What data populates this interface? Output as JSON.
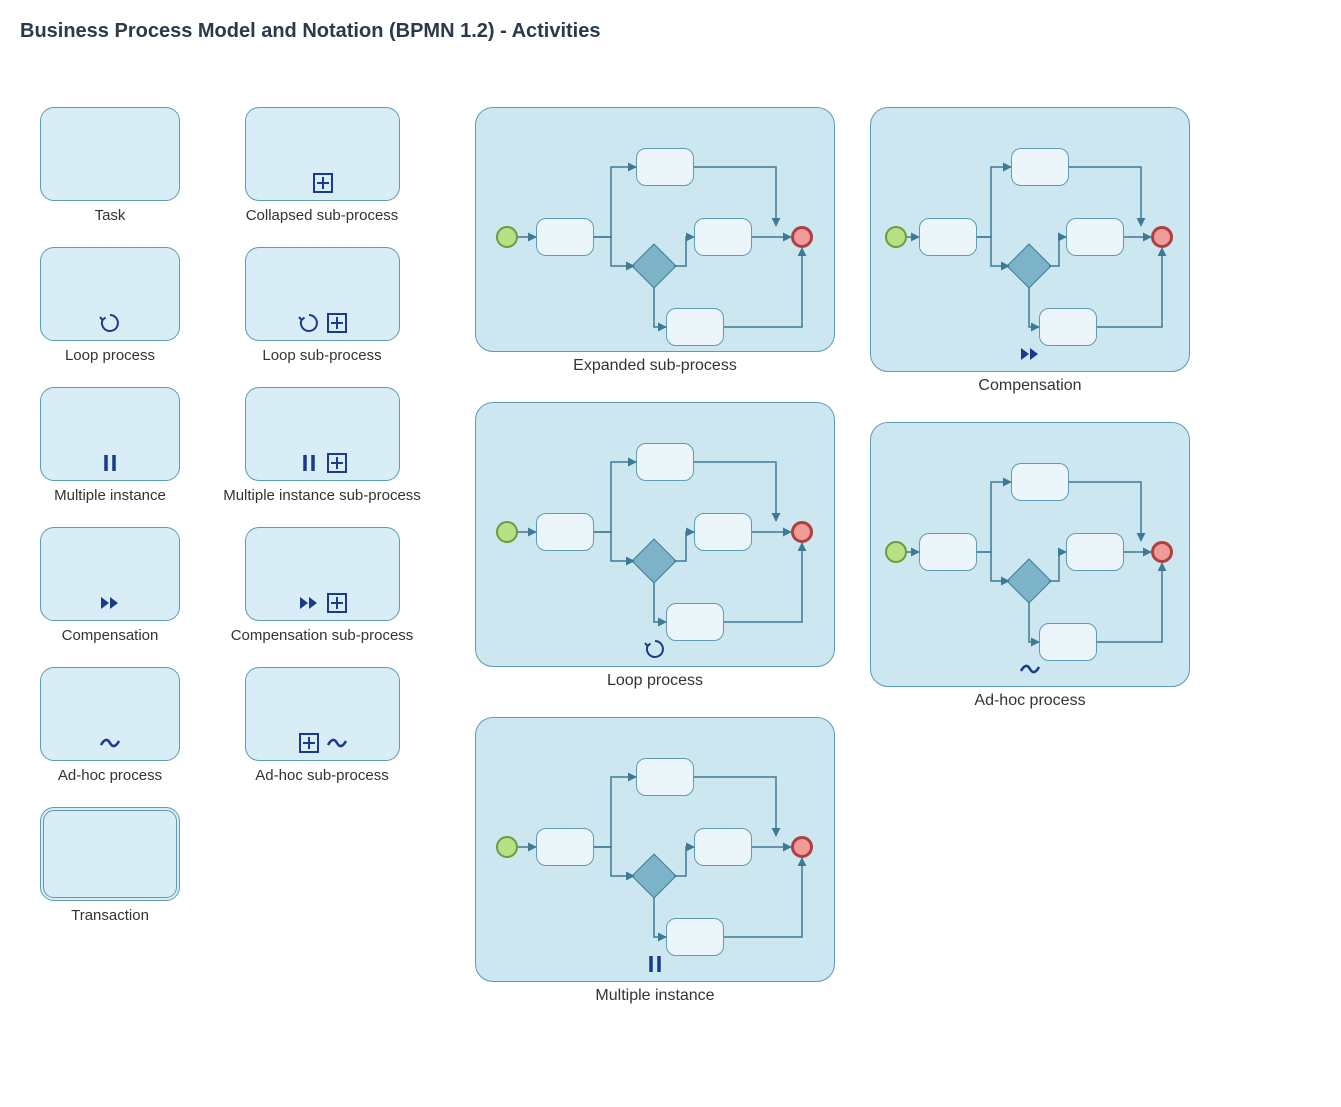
{
  "title": "Business Process Model and Notation (BPMN 1.2) - Activities",
  "col1": {
    "task": "Task",
    "loop": "Loop process",
    "multi": "Multiple instance",
    "comp": "Compensation",
    "adhoc": "Ad-hoc process",
    "trans": "Transaction"
  },
  "col2": {
    "collapsed": "Collapsed sub-process",
    "loopsub": "Loop sub-process",
    "multisub": "Multiple instance sub-process",
    "compsub": "Compensation sub-process",
    "adhocsub": "Ad-hoc sub-process"
  },
  "big": {
    "expanded": "Expanded sub-process",
    "loop": "Loop process",
    "multi": "Multiple instance",
    "comp": "Compensation",
    "adhoc": "Ad-hoc process"
  }
}
